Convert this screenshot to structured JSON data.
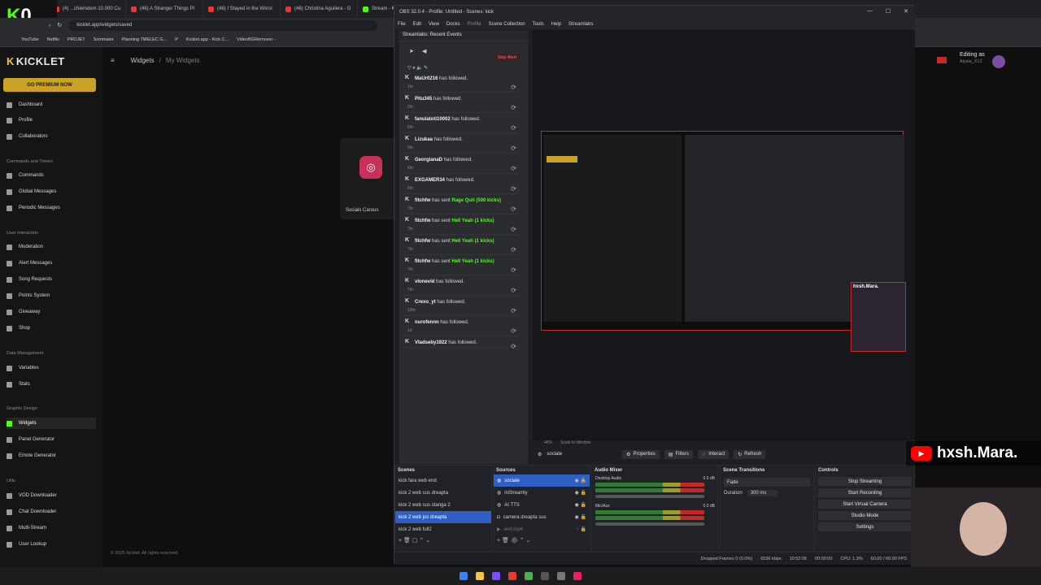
{
  "browser": {
    "tabs": [
      {
        "label": "(4) ...chiemdem 10.000 Cu"
      },
      {
        "label": "(46) A Stranger Things Pl"
      },
      {
        "label": "(46) I Stayed in the Worst"
      },
      {
        "label": "(46) Christina Aguilera - G"
      },
      {
        "label": "Stream - Ki"
      }
    ],
    "url": "kicklet.app/widgets/saved",
    "bookmarks": [
      "YouTube",
      "Netflix",
      "PROJET",
      "Sommaire",
      "Planning TMELEC G...",
      "P",
      "Kicklet.app - Kick C...",
      "VideoBGRemover -"
    ]
  },
  "overlay_logo": {
    "k": "K",
    "num": "0"
  },
  "kicklet": {
    "brand": "KICKLET",
    "premium_label": "GO PREMIUM NOW",
    "sections": {
      "commands": "Commands and Timers",
      "interaction": "User Interaction",
      "data": "Data Management",
      "graphic": "Graphic Design",
      "utils": "Utils"
    },
    "nav": {
      "dashboard": "Dashboard",
      "profile": "Profile",
      "collaborators": "Collaborators",
      "commands": "Commands",
      "global_messages": "Global Messages",
      "periodic_messages": "Periodic Messages",
      "moderation": "Moderation",
      "alert_messages": "Alert Messages",
      "song_requests": "Song Requests",
      "points_system": "Points System",
      "giveaway": "Giveaway",
      "shop": "Shop",
      "variables": "Variables",
      "stats": "Stats",
      "widgets": "Widgets",
      "panel_generator": "Panel Generator",
      "emote_generator": "Emote Generator",
      "vod_downloader": "VOD Downloader",
      "chat_downloader": "Chat Downloader",
      "multi_stream": "Multi-Stream",
      "user_lookup": "User Lookup"
    },
    "breadcrumb": {
      "root": "Widgets",
      "sep": "/",
      "current": "My Widgets"
    },
    "card_label": "Socials Carous",
    "editing_as": "Editing as",
    "editing_user": "Alysia_X12",
    "footer": "© 2025 Kicklet. All rights reserved."
  },
  "obs": {
    "title": "OBS 32.0.4 - Profile: Untitled - Scenes: kick",
    "menu": [
      "File",
      "Edit",
      "View",
      "Docks",
      "Profile",
      "Scene Collection",
      "Tools",
      "Help",
      "Streamlabs"
    ],
    "events_title": "Streamlabs: Recent Events",
    "skip_alert": "Skip Alert",
    "events": [
      {
        "user": "MaUr0216",
        "rest": " has followed.",
        "gift": "",
        "time": "1hr"
      },
      {
        "user": "Pitu345",
        "rest": " has followed.",
        "gift": "",
        "time": "2hr"
      },
      {
        "user": "fanulatoti10002",
        "rest": " has followed.",
        "gift": "",
        "time": "6hr"
      },
      {
        "user": "Lizukaa",
        "rest": " has followed.",
        "gift": "",
        "time": "6hr"
      },
      {
        "user": "GeorgianaD",
        "rest": " has followed.",
        "gift": "",
        "time": "6hr"
      },
      {
        "user": "EXGAMER34",
        "rest": " has followed.",
        "gift": "",
        "time": "6hr"
      },
      {
        "user": "fitchfw",
        "rest": " has sent ",
        "gift": "Rage Quit (500 kicks)",
        "time": "7hr"
      },
      {
        "user": "fitchfw",
        "rest": " has sent ",
        "gift": "Hell Yeah (1 kicks)",
        "time": "7hr"
      },
      {
        "user": "fitchfw",
        "rest": " has sent ",
        "gift": "Hell Yeah (1 kicks)",
        "time": "7hr"
      },
      {
        "user": "fitchfw",
        "rest": " has sent ",
        "gift": "Hell Yeah (1 kicks)",
        "time": "7hr"
      },
      {
        "user": "vlonevid",
        "rest": " has followed.",
        "gift": "",
        "time": "7hr"
      },
      {
        "user": "Crexo_yt",
        "rest": " has followed.",
        "gift": "",
        "time": "10hr"
      },
      {
        "user": "nurofennn",
        "rest": " has followed.",
        "gift": "",
        "time": "1d"
      },
      {
        "user": "Vladseby1922",
        "rest": " has followed.",
        "gift": "",
        "time": ""
      }
    ],
    "canvas_bar": {
      "zoom": "46%",
      "scale": "Scale to Window"
    },
    "preview_cam_name": "hxsh.Mara.",
    "toolbar": {
      "scene": "sociale",
      "properties": "Properties",
      "filters": "Filters",
      "interact": "Interact",
      "refresh": "Refresh"
    },
    "scenes_title": "Scenes",
    "scenes": [
      "kick fara web end",
      "kick 2 web sus dreapta",
      "kick 2 web sus stanga 2",
      "kick 2 web jos dreapta",
      "kick 2 web full2"
    ],
    "sources_title": "Sources",
    "sources": [
      "sociale",
      "inStreamly",
      "AI TTS",
      "camera dreapta sus",
      "end.mp4"
    ],
    "mixer_title": "Audio Mixer",
    "mixer": [
      {
        "name": "Desktop Audio",
        "db": "0.0 dB"
      },
      {
        "name": "Mic/Aux",
        "db": "0.0 dB"
      }
    ],
    "transitions_title": "Scene Transitions",
    "transition_value": "Fade",
    "duration_label": "Duration",
    "duration_value": "300 ms",
    "controls_title": "Controls",
    "controls": [
      "Stop Streaming",
      "Start Recording",
      "Start Virtual Camera",
      "Studio Mode",
      "Settings"
    ],
    "status": {
      "dropped": "Dropped Frames 0 (0.0%)",
      "bitrate": "6536 kbps",
      "live": "10:52:05",
      "rec": "00:00:00",
      "cpu": "CPU: 1.3%",
      "fps": "60.00 / 60.00 FPS"
    }
  },
  "stream_overlay": {
    "yt": "▶",
    "name": "hxsh.Mara."
  },
  "colors": {
    "accent": "#53fc18",
    "obs_select": "#2f5fc4",
    "premium": "#c9a227",
    "rec_red": "#c62828"
  }
}
